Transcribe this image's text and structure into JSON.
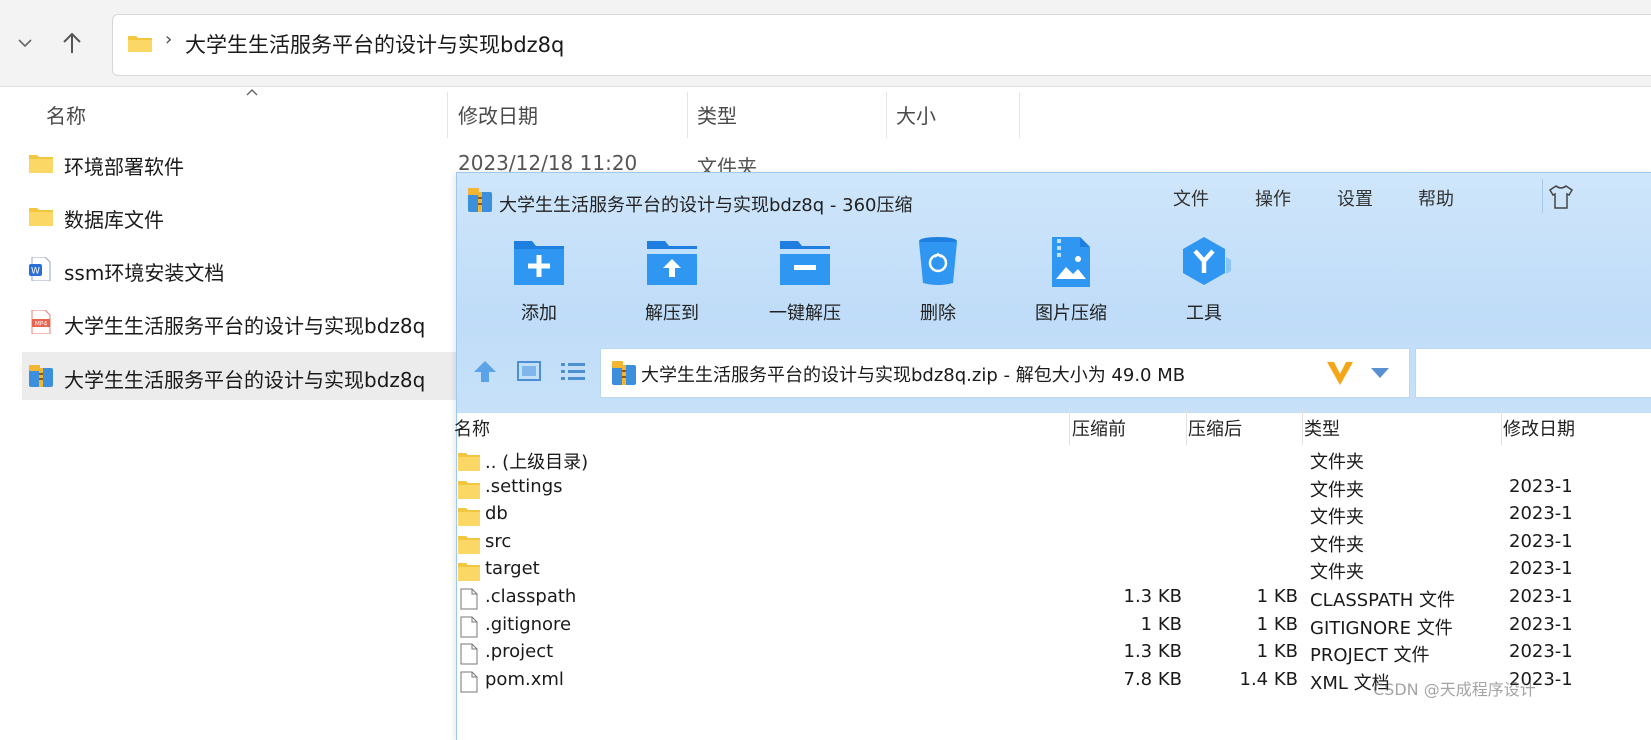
{
  "explorer": {
    "path": "大学生生活服务平台的设计与实现bdz8q",
    "columns": {
      "name": "名称",
      "modified": "修改日期",
      "type": "类型",
      "size": "大小"
    },
    "files": [
      {
        "name": "环境部署软件",
        "modified": "2023/12/18 11:20",
        "type": "文件夹",
        "icon": "folder-icon"
      },
      {
        "name": "数据库文件",
        "icon": "folder-icon"
      },
      {
        "name": "ssm环境安装文档",
        "icon": "word-doc-icon"
      },
      {
        "name": "大学生生活服务平台的设计与实现bdz8q",
        "icon": "mp4-file-icon"
      },
      {
        "name": "大学生生活服务平台的设计与实现bdz8q",
        "icon": "zip-archive-icon",
        "selected": true
      }
    ]
  },
  "zip_window": {
    "title": "大学生生活服务平台的设计与实现bdz8q - 360压缩",
    "menu": [
      "文件",
      "操作",
      "设置",
      "帮助"
    ],
    "toolbar": [
      {
        "label": "添加",
        "icon": "add-folder-icon"
      },
      {
        "label": "解压到",
        "icon": "extract-to-icon"
      },
      {
        "label": "一键解压",
        "icon": "one-click-extract-icon"
      },
      {
        "label": "删除",
        "icon": "recycle-bin-icon"
      },
      {
        "label": "图片压缩",
        "icon": "image-compress-icon"
      },
      {
        "label": "工具",
        "icon": "tools-icon"
      }
    ],
    "address": "大学生生活服务平台的设计与实现bdz8q.zip - 解包大小为 49.0 MB",
    "columns": {
      "name": "名称",
      "before": "压缩前",
      "after": "压缩后",
      "type": "类型",
      "modified": "修改日期"
    },
    "rows": [
      {
        "name": ".. (上级目录)",
        "before": "",
        "after": "",
        "type": "文件夹",
        "date": "",
        "icon": "folder-icon"
      },
      {
        "name": ".settings",
        "before": "",
        "after": "",
        "type": "文件夹",
        "date": "2023-1",
        "icon": "folder-icon"
      },
      {
        "name": "db",
        "before": "",
        "after": "",
        "type": "文件夹",
        "date": "2023-1",
        "icon": "folder-icon"
      },
      {
        "name": "src",
        "before": "",
        "after": "",
        "type": "文件夹",
        "date": "2023-1",
        "icon": "folder-icon"
      },
      {
        "name": "target",
        "before": "",
        "after": "",
        "type": "文件夹",
        "date": "2023-1",
        "icon": "folder-icon"
      },
      {
        "name": ".classpath",
        "before": "1.3 KB",
        "after": "1 KB",
        "type": "CLASSPATH 文件",
        "date": "2023-1",
        "icon": "file-icon"
      },
      {
        "name": ".gitignore",
        "before": "1 KB",
        "after": "1 KB",
        "type": "GITIGNORE 文件",
        "date": "2023-1",
        "icon": "file-icon"
      },
      {
        "name": ".project",
        "before": "1.3 KB",
        "after": "1 KB",
        "type": "PROJECT 文件",
        "date": "2023-1",
        "icon": "file-icon"
      },
      {
        "name": "pom.xml",
        "before": "7.8 KB",
        "after": "1.4 KB",
        "type": "XML 文档",
        "date": "2023-1",
        "icon": "file-icon"
      }
    ]
  },
  "watermark": "CSDN @天成程序设计"
}
